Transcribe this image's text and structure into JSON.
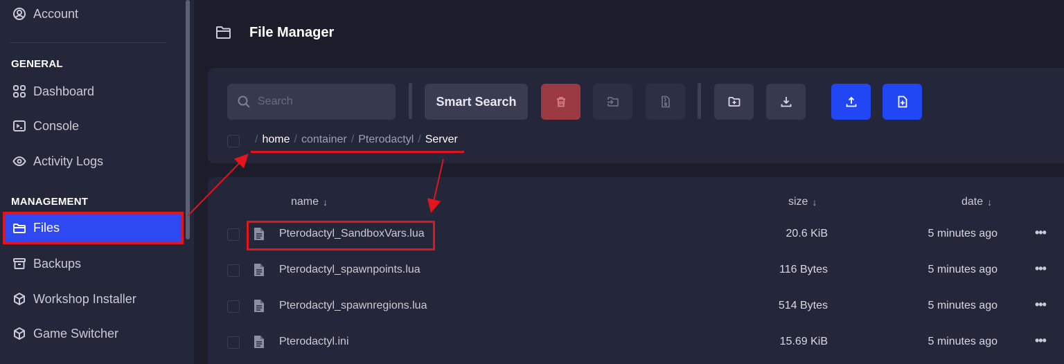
{
  "sidebar": {
    "account_label": "Account",
    "sections": {
      "general": "GENERAL",
      "management": "MANAGEMENT"
    },
    "general_items": [
      {
        "label": "Dashboard",
        "icon": "grid-icon"
      },
      {
        "label": "Console",
        "icon": "terminal-icon"
      },
      {
        "label": "Activity Logs",
        "icon": "eye-icon"
      }
    ],
    "management_items": [
      {
        "label": "Files",
        "icon": "folder-icon",
        "active": true
      },
      {
        "label": "Backups",
        "icon": "archive-icon"
      },
      {
        "label": "Workshop Installer",
        "icon": "package-icon"
      },
      {
        "label": "Game Switcher",
        "icon": "package-icon"
      }
    ]
  },
  "header": {
    "title": "File Manager"
  },
  "toolbar": {
    "search_placeholder": "Search",
    "smart_search_label": "Smart Search",
    "buttons": [
      {
        "name": "delete",
        "icon": "trash-icon",
        "color": "#9b3a42"
      },
      {
        "name": "move",
        "icon": "move-icon"
      },
      {
        "name": "archive",
        "icon": "file-archive-icon"
      },
      {
        "name": "new-folder",
        "icon": "folder-plus-icon"
      },
      {
        "name": "download",
        "icon": "download-icon"
      },
      {
        "name": "upload",
        "icon": "upload-icon",
        "color": "#2147f5"
      },
      {
        "name": "new-file",
        "icon": "file-plus-icon",
        "color": "#2147f5"
      }
    ]
  },
  "breadcrumb": {
    "separator": "/",
    "parts": [
      "home",
      "container",
      "Pterodactyl",
      "Server"
    ]
  },
  "file_table": {
    "columns": {
      "name": "name",
      "size": "size",
      "date": "date",
      "sort_arrow": "↓"
    },
    "rows": [
      {
        "name": "Pterodactyl_SandboxVars.lua",
        "size": "20.6 KiB",
        "date": "5 minutes ago",
        "menu": "•••"
      },
      {
        "name": "Pterodactyl_spawnpoints.lua",
        "size": "116 Bytes",
        "date": "5 minutes ago",
        "menu": "•••"
      },
      {
        "name": "Pterodactyl_spawnregions.lua",
        "size": "514 Bytes",
        "date": "5 minutes ago",
        "menu": "•••"
      },
      {
        "name": "Pterodactyl.ini",
        "size": "15.69 KiB",
        "date": "5 minutes ago",
        "menu": "•••"
      }
    ]
  },
  "colors": {
    "accent_blue": "#2f49f2",
    "annotation_red": "#e3141c",
    "background": "#1b1d2b",
    "panel": "#24263a"
  }
}
